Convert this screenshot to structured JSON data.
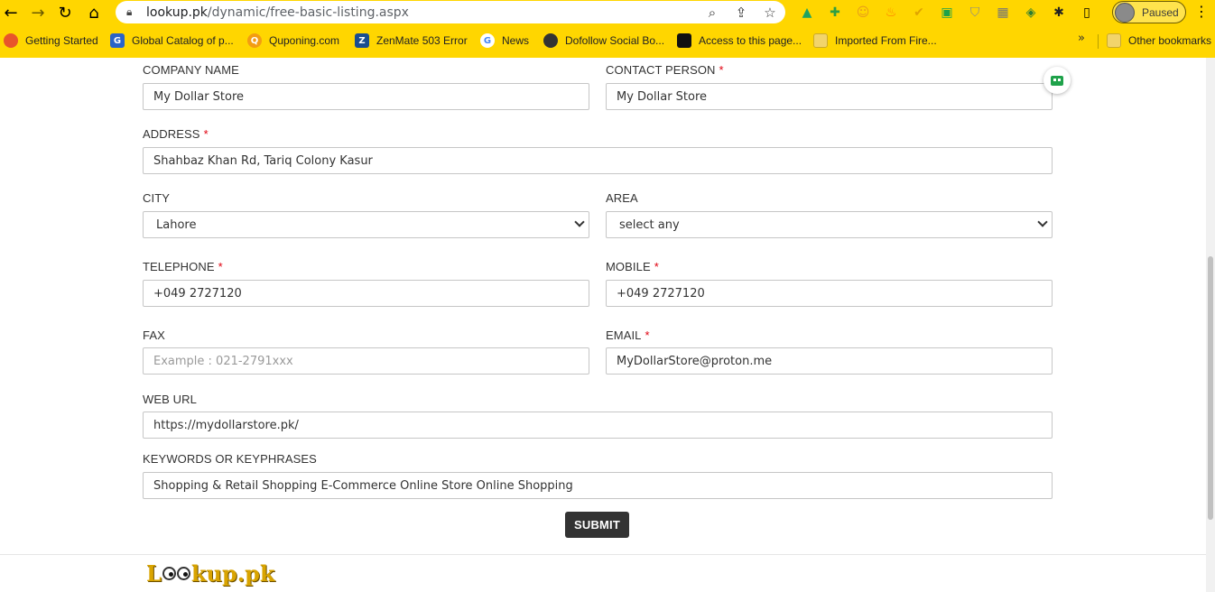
{
  "browser": {
    "url_host": "lookup.pk",
    "url_path": "/dynamic/free-basic-listing.aspx",
    "profile_label": "Paused",
    "bookmarks": [
      {
        "label": "Getting Started",
        "icon": "firefox-icon",
        "color": "#e8552b"
      },
      {
        "label": "Global Catalog of p...",
        "icon": "gc-icon",
        "color": "#2a63c9"
      },
      {
        "label": "Quponing.com",
        "icon": "quponing-icon",
        "color": "#f39c12"
      },
      {
        "label": "ZenMate 503 Error",
        "icon": "zenmate-icon",
        "color": "#1a4d8f"
      },
      {
        "label": "News",
        "icon": "google-icon",
        "color": "#4285f4"
      },
      {
        "label": "Dofollow Social Bo...",
        "icon": "globe-icon",
        "color": "#333333"
      },
      {
        "label": "Access to this page...",
        "icon": "black-square-icon",
        "color": "#111111"
      },
      {
        "label": "Imported From Fire...",
        "icon": "folder-icon",
        "color": "#f2d46b"
      }
    ],
    "other_bookmarks": "Other bookmarks",
    "more_glyph": "»"
  },
  "form": {
    "company_name": {
      "label": "COMPANY NAME",
      "value": "My Dollar Store"
    },
    "contact_person": {
      "label": "CONTACT PERSON",
      "required": "*",
      "value": "My Dollar Store"
    },
    "address": {
      "label": "ADDRESS",
      "required": "*",
      "value": "Shahbaz Khan Rd, Tariq Colony Kasur"
    },
    "city": {
      "label": "CITY",
      "value": "Lahore"
    },
    "area": {
      "label": "AREA",
      "value": "select any"
    },
    "telephone": {
      "label": "TELEPHONE",
      "required": "*",
      "value": "+049 2727120"
    },
    "mobile": {
      "label": "MOBILE",
      "required": "*",
      "value": "+049 2727120"
    },
    "fax": {
      "label": "FAX",
      "placeholder": "Example : 021-2791xxx"
    },
    "email": {
      "label": "EMAIL",
      "required": "*",
      "value": "MyDollarStore@proton.me"
    },
    "web_url": {
      "label": "WEB URL",
      "value": "https://mydollarstore.pk/"
    },
    "keywords": {
      "label": "KEYWORDS OR KEYPHRASES",
      "value": "Shopping & Retail Shopping E-Commerce Online Store Online Shopping"
    },
    "submit_label": "SUBMIT"
  },
  "footer": {
    "logo_left": "L",
    "logo_right": "kup.pk"
  },
  "colors": {
    "chrome_bg": "#ffd600",
    "required_star": "#e0000f",
    "submit_bg": "#333333"
  }
}
